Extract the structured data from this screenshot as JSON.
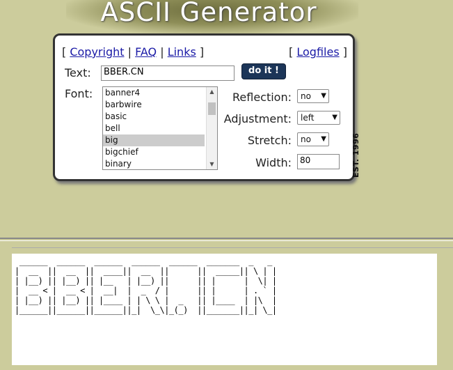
{
  "header": {
    "title": "ASCII Generator"
  },
  "nav": {
    "open_bracket": "[",
    "close_bracket": "]",
    "sep": "|",
    "copyright": "Copyright",
    "faq": "FAQ",
    "links": "Links",
    "logfiles": "Logfiles"
  },
  "form": {
    "text_label": "Text:",
    "text_value": "BBER.CN",
    "submit_label": "do it !",
    "font_label": "Font:",
    "fonts": [
      "banner4",
      "barbwire",
      "basic",
      "bell",
      "big",
      "bigchief",
      "binary"
    ],
    "selected_font": "big",
    "reflection_label": "Reflection:",
    "reflection_value": "no",
    "adjustment_label": "Adjustment:",
    "adjustment_value": "left",
    "stretch_label": "Stretch:",
    "stretch_value": "no",
    "width_label": "Width:",
    "width_value": "80",
    "established": "EST. 1996"
  },
  "output": {
    "ascii": " ______  ______  ______  ______  ______  _______  _   _ \n|  __  ||  __  ||  ____||  __  ||      ||  _____|| \\ | |\n| |__) || |__) || |__   | |__) ||      || |      |  \\| |\n|  __ < |  __ < |  __|  |  _  / |      || |      | . ` |\n| |__) || |__) || |____ | | \\ \\ |  _   || |____  | |\\  |\n|______||______||______||_|  \\_\\|_(_)  ||_______||_| \\_|"
  }
}
